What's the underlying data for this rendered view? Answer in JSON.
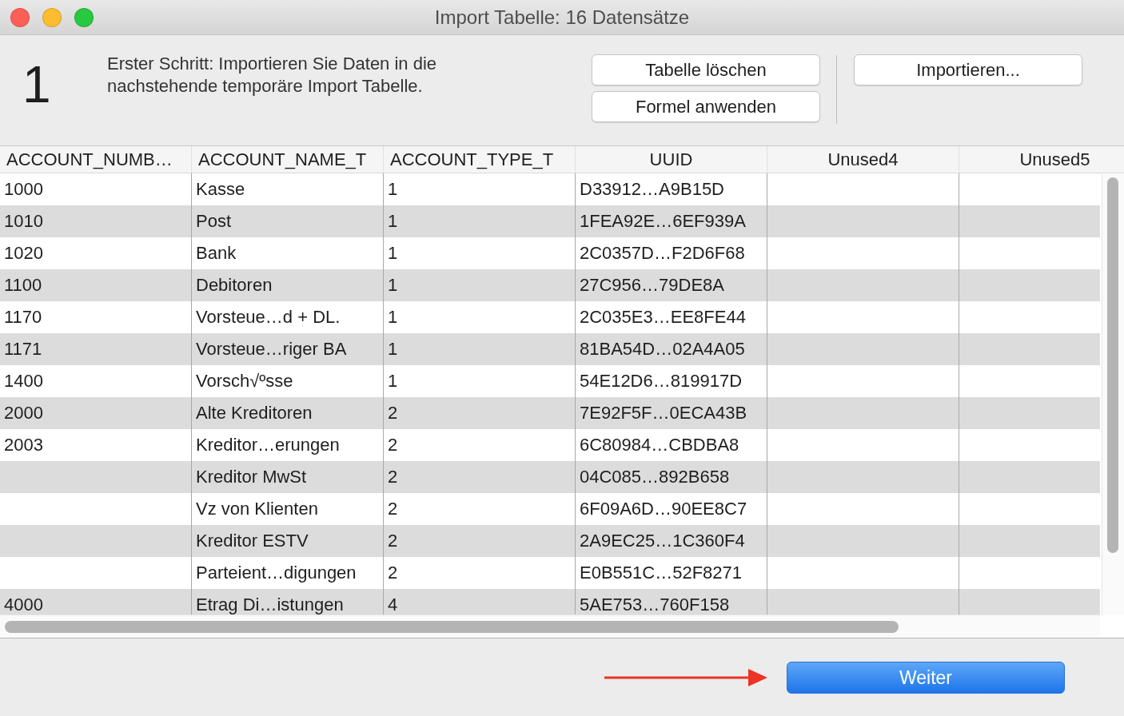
{
  "window": {
    "title": "Import Tabelle: 16 Datensätze"
  },
  "step": {
    "number": "1",
    "text": "Erster Schritt: Importieren Sie Daten in die nachstehende temporäre Import Tabelle."
  },
  "actions": {
    "column_1": [
      "Tabelle löschen",
      "Formel anwenden"
    ],
    "column_2": [
      "Importieren..."
    ]
  },
  "table": {
    "columns": [
      "ACCOUNT_NUMB…",
      "ACCOUNT_NAME_T",
      "ACCOUNT_TYPE_T",
      "UUID",
      "Unused4",
      "Unused5"
    ],
    "rows": [
      [
        "1000",
        "Kasse",
        "1",
        "D33912…A9B15D"
      ],
      [
        "1010",
        "Post",
        "1",
        "1FEA92E…6EF939A"
      ],
      [
        "1020",
        "Bank",
        "1",
        "2C0357D…F2D6F68"
      ],
      [
        "1100",
        "Debitoren",
        "1",
        "27C956…79DE8A"
      ],
      [
        "1170",
        "Vorsteue…d + DL.",
        "1",
        "2C035E3…EE8FE44"
      ],
      [
        "1171",
        "Vorsteue…riger BA",
        "1",
        "81BA54D…02A4A05"
      ],
      [
        "1400",
        "Vorsch√ºsse",
        "1",
        "54E12D6…819917D"
      ],
      [
        "2000",
        "Alte Kreditoren",
        "2",
        "7E92F5F…0ECA43B"
      ],
      [
        "2003",
        "Kreditor…erungen",
        "2",
        "6C80984…CBDBA8"
      ],
      [
        "",
        "Kreditor MwSt",
        "2",
        "04C085…892B658"
      ],
      [
        "",
        "Vz von Klienten",
        "2",
        "6F09A6D…90EE8C7"
      ],
      [
        "",
        "Kreditor ESTV",
        "2",
        "2A9EC25…1C360F4"
      ],
      [
        "",
        "Parteient…digungen",
        "2",
        "E0B551C…52F8271"
      ],
      [
        "4000",
        "Etrag Di…istungen",
        "4",
        "5AE753…760F158"
      ]
    ]
  },
  "primary_button": "Weiter"
}
